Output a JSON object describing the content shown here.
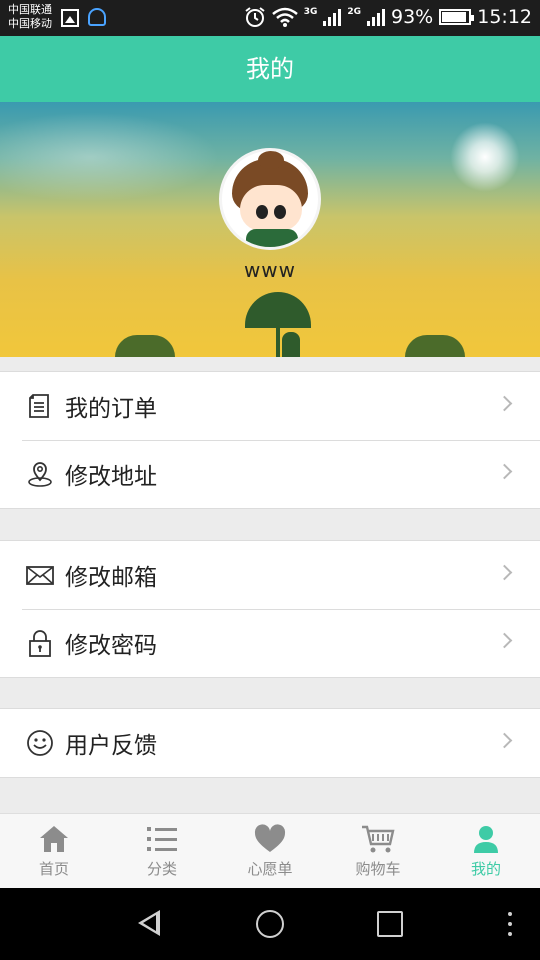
{
  "status_bar": {
    "carrier_1": "中国联通",
    "carrier_2": "中国移动",
    "net_1": "3G",
    "net_2": "2G",
    "battery": "93%",
    "time": "15:12"
  },
  "title_bar": {
    "title": "我的"
  },
  "profile": {
    "username": "www"
  },
  "menu": {
    "orders": "我的订单",
    "address": "修改地址",
    "email": "修改邮箱",
    "password": "修改密码",
    "feedback": "用户反馈"
  },
  "bottom_nav": {
    "home": "首页",
    "category": "分类",
    "wishlist": "心愿单",
    "cart": "购物车",
    "mine": "我的"
  },
  "colors": {
    "accent": "#3ecba6",
    "inactive": "#8c8c8c"
  }
}
